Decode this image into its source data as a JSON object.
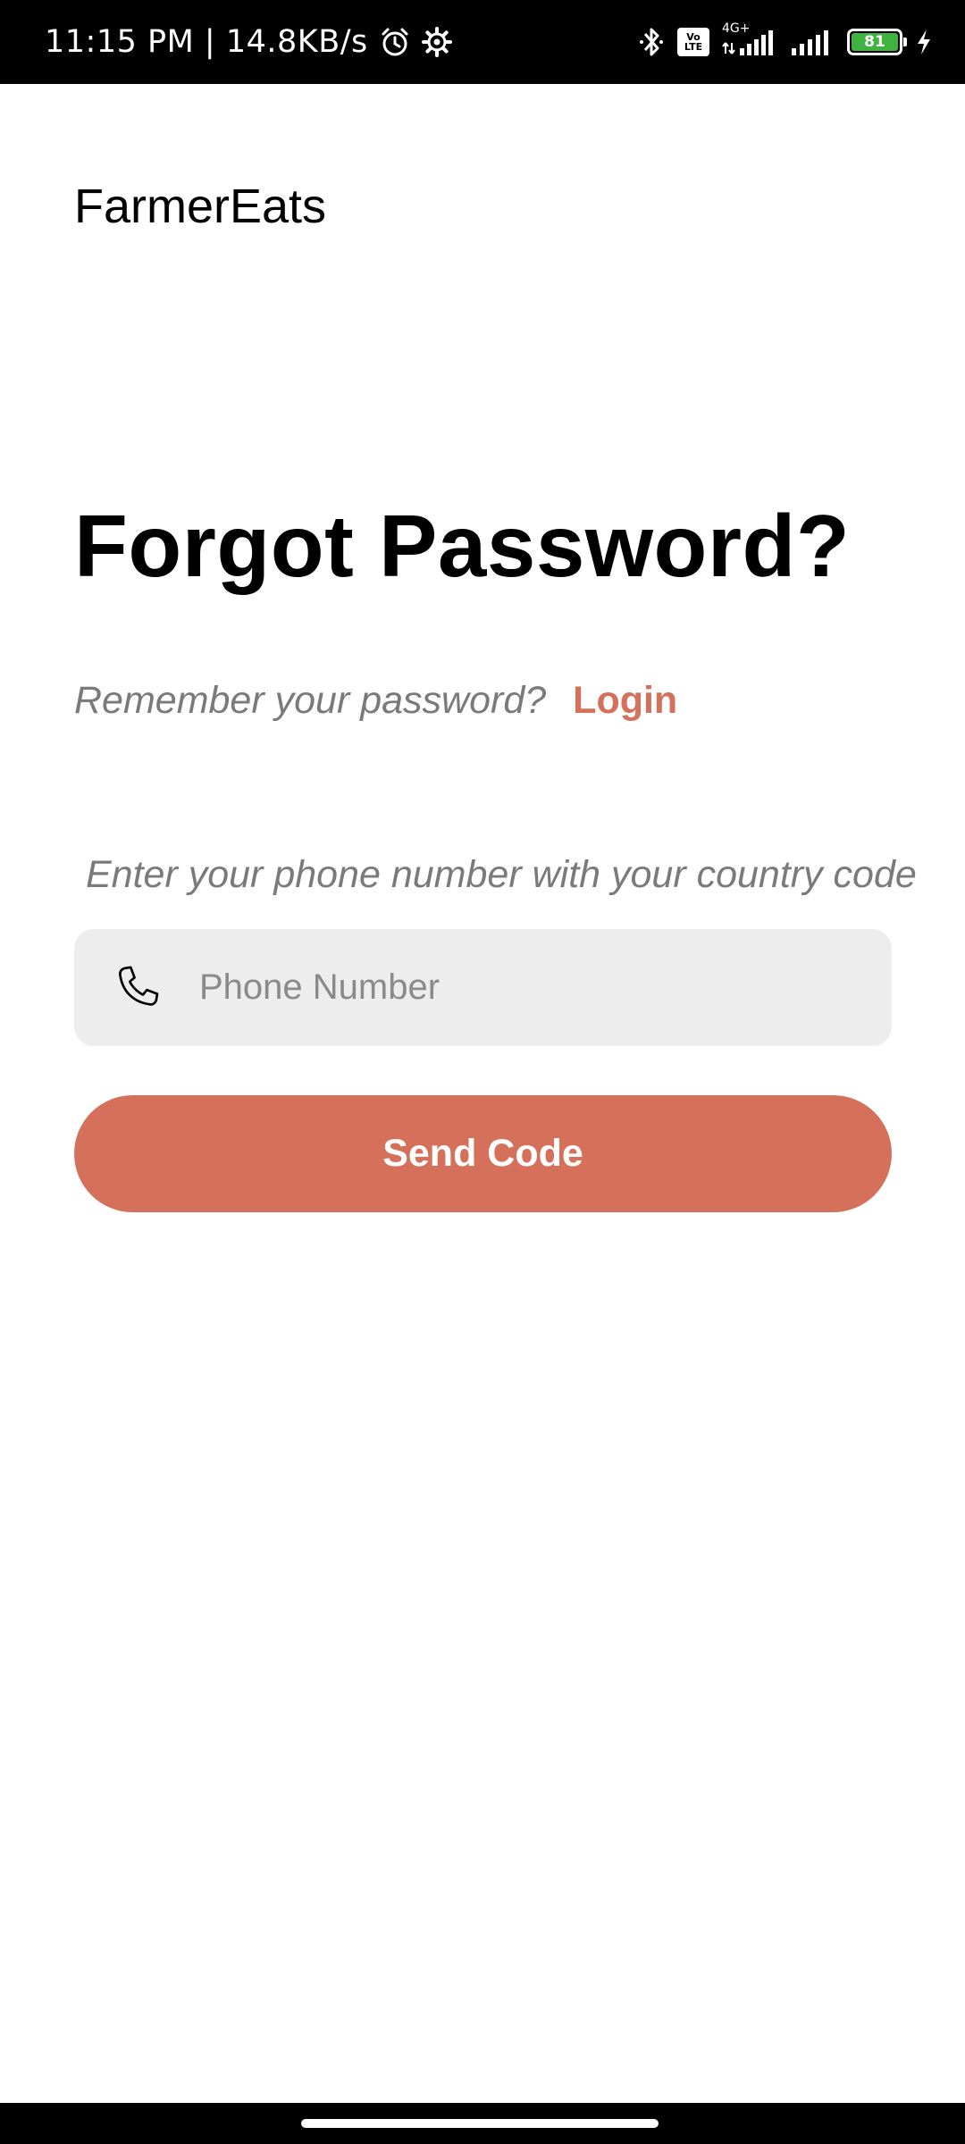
{
  "status_bar": {
    "time_speed": "11:15 PM | 14.8KB/s",
    "network_label": "4G+",
    "volte_top": "Vo",
    "volte_bottom": "LTE",
    "battery_level": "81",
    "icons": [
      "alarm-icon",
      "settings-icon",
      "bluetooth-icon",
      "volte-icon",
      "signal-icon",
      "signal-icon",
      "battery-icon",
      "charging-icon"
    ]
  },
  "app": {
    "brand": "FarmerEats"
  },
  "main": {
    "title": "Forgot Password?",
    "remember_text": "Remember your password?",
    "login_link": "Login",
    "instruction": "Enter your phone number with your country code",
    "phone_field": {
      "icon": "phone-icon",
      "value": "",
      "placeholder": "Phone Number"
    },
    "send_button": "Send Code"
  },
  "colors": {
    "accent": "#D5715B",
    "field_background": "#EDEDED",
    "muted_text": "#7A7A7A"
  }
}
